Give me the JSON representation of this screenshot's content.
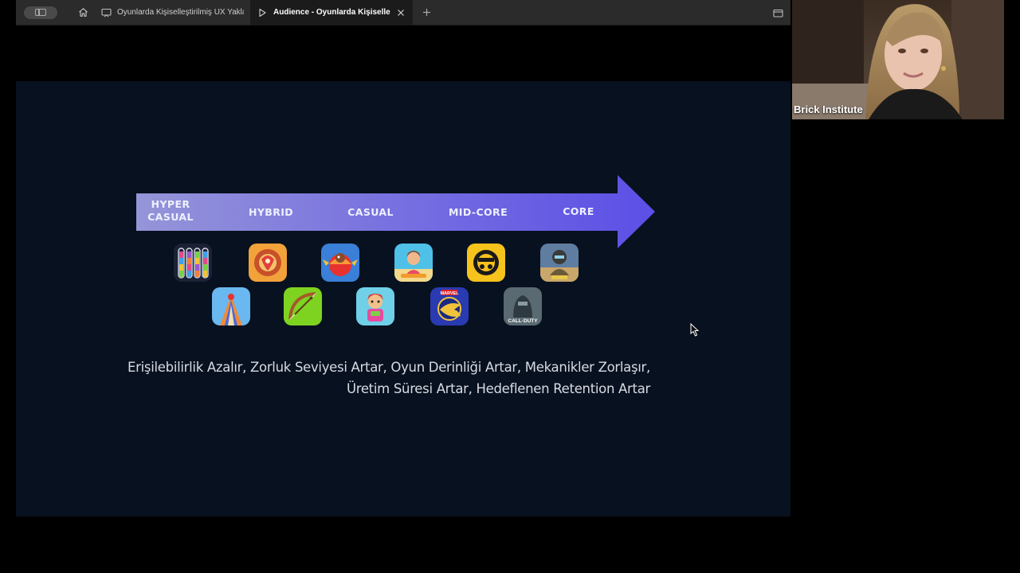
{
  "browser": {
    "tabs": [
      {
        "title": "Oyunlarda Kişiselleştirilmiş UX Yaklaş",
        "icon": "presentation-icon",
        "active": false
      },
      {
        "title": "Audience - Oyunlarda Kişiselleştir",
        "icon": "play-icon",
        "active": true
      }
    ]
  },
  "slide": {
    "stages": [
      {
        "label": "HYPER\nCASUAL"
      },
      {
        "label": "HYBRID"
      },
      {
        "label": "CASUAL"
      },
      {
        "label": "MID-CORE"
      },
      {
        "label": "CORE"
      }
    ],
    "caption_line1": "Erişilebilirlik Azalır, Zorluk Seviyesi Artar, Oyun Derinliği Artar, Mekanikler Zorlaşır,",
    "caption_line2": "Üretim Süresi Artar, Hedeflenen Retention Artar",
    "app_icons_row1": [
      "water-sort-game-icon",
      "hybrid-game-icon",
      "candy-crush-icon",
      "casual-game-icon",
      "brawl-stars-icon",
      "pubg-icon"
    ],
    "app_icons_row2": [
      "hoop-run-icon",
      "archery-game-icon",
      "subway-surfers-icon",
      "marvel-game-icon",
      "call-of-duty-icon"
    ],
    "icon_labels": {
      "marvel": "MARVEL",
      "cod": "CALL·DUTY"
    }
  },
  "video": {
    "participant_name": "Brick Institute"
  },
  "colors": {
    "tabbar": "#2b2b2b",
    "active_tab": "#1b1b1b",
    "slide_bg": "#08111f",
    "arrow_start": "#8f8fdc",
    "arrow_end": "#5b4fe6"
  }
}
